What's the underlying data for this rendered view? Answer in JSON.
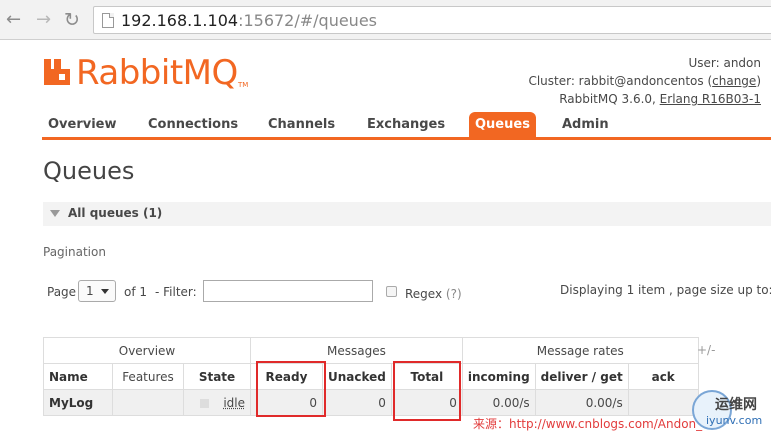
{
  "browser": {
    "url_host": "192.168.1.104",
    "url_rest": ":15672/#/queues"
  },
  "header": {
    "logo_text": "RabbitMQ",
    "logo_tm": "TM",
    "user_line": "User: andon",
    "cluster_prefix": "Cluster: rabbit@andoncentos (",
    "cluster_change": "change",
    "cluster_suffix": ")",
    "version_prefix": "RabbitMQ 3.6.0, ",
    "erlang": "Erlang R16B03-1"
  },
  "tabs": [
    {
      "label": "Overview",
      "active": false
    },
    {
      "label": "Connections",
      "active": false
    },
    {
      "label": "Channels",
      "active": false
    },
    {
      "label": "Exchanges",
      "active": false
    },
    {
      "label": "Queues",
      "active": true
    },
    {
      "label": "Admin",
      "active": false
    }
  ],
  "page_title": "Queues",
  "section_label": "All queues (1)",
  "pagination": {
    "label": "Pagination",
    "page_label": "Page",
    "page_value": "1",
    "of_label": "of 1",
    "filter_label": "- Filter:",
    "filter_value": "",
    "regex_label": "Regex",
    "regex_help": "(?)",
    "displaying": "Displaying 1 item , page size up to:"
  },
  "table": {
    "groups": [
      "Overview",
      "Messages",
      "Message rates"
    ],
    "plusminus": "+/-",
    "headers": [
      "Name",
      "Features",
      "State",
      "Ready",
      "Unacked",
      "Total",
      "incoming",
      "deliver / get",
      "ack"
    ],
    "rows": [
      {
        "name": "MyLog",
        "features": "",
        "state": "idle",
        "ready": "0",
        "unacked": "0",
        "total": "0",
        "incoming": "0.00/s",
        "deliver_get": "0.00/s",
        "ack": ""
      }
    ]
  },
  "watermark": {
    "text": "来源：http://www.cnblogs.com/Andon_liu",
    "site_cn": "运维网",
    "site_en": "iyunv.com"
  },
  "colors": {
    "brand": "#f26722",
    "highlight": "#e02a2a"
  }
}
